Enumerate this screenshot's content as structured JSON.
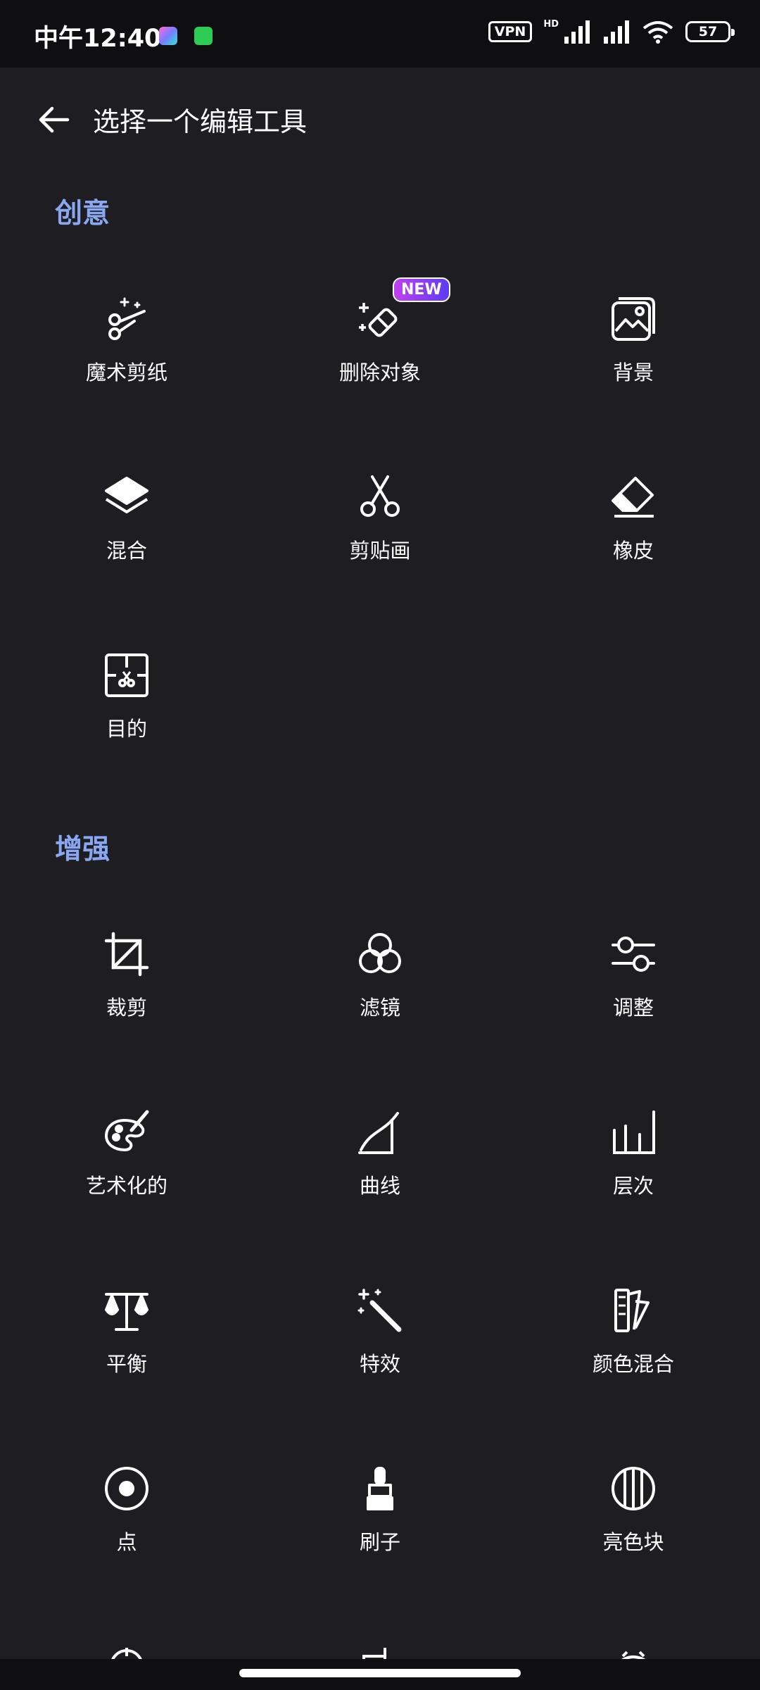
{
  "status_bar": {
    "time": "中午12:40",
    "vpn": "VPN",
    "hd": "HD",
    "battery": "57",
    "icons": [
      "app-icon",
      "download-icon",
      "signal-icon",
      "signal-icon",
      "wifi-icon",
      "battery-icon"
    ]
  },
  "header": {
    "title": "选择一个编辑工具",
    "back_icon": "arrow-left-icon"
  },
  "sections": [
    {
      "title": "创意",
      "tools": [
        {
          "label": "魔术剪纸",
          "icon": "magic-scissors-icon"
        },
        {
          "label": "删除对象",
          "icon": "eraser-sparkle-icon",
          "badge": "NEW"
        },
        {
          "label": "背景",
          "icon": "image-stack-icon"
        },
        {
          "label": "混合",
          "icon": "layers-icon"
        },
        {
          "label": "剪贴画",
          "icon": "scissors-icon"
        },
        {
          "label": "橡皮",
          "icon": "eraser-icon"
        },
        {
          "label": "目的",
          "icon": "cutout-frame-icon"
        }
      ]
    },
    {
      "title": "增强",
      "tools": [
        {
          "label": "裁剪",
          "icon": "crop-icon"
        },
        {
          "label": "滤镜",
          "icon": "filter-circles-icon"
        },
        {
          "label": "调整",
          "icon": "sliders-icon"
        },
        {
          "label": "艺术化的",
          "icon": "palette-icon"
        },
        {
          "label": "曲线",
          "icon": "curve-icon"
        },
        {
          "label": "层次",
          "icon": "levels-icon"
        },
        {
          "label": "平衡",
          "icon": "balance-scale-icon"
        },
        {
          "label": "特效",
          "icon": "magic-wand-icon"
        },
        {
          "label": "颜色混合",
          "icon": "swatch-fan-icon"
        },
        {
          "label": "点",
          "icon": "target-dot-icon"
        },
        {
          "label": "刷子",
          "icon": "brush-icon"
        },
        {
          "label": "亮色块",
          "icon": "striped-circle-icon"
        }
      ]
    }
  ],
  "colors": {
    "background": "#1d1d22",
    "status_bar": "#0f0f12",
    "section_title": "#8aa7f2",
    "text": "#ffffff",
    "badge_gradient": [
      "#c040f0",
      "#5b3cf5"
    ]
  }
}
